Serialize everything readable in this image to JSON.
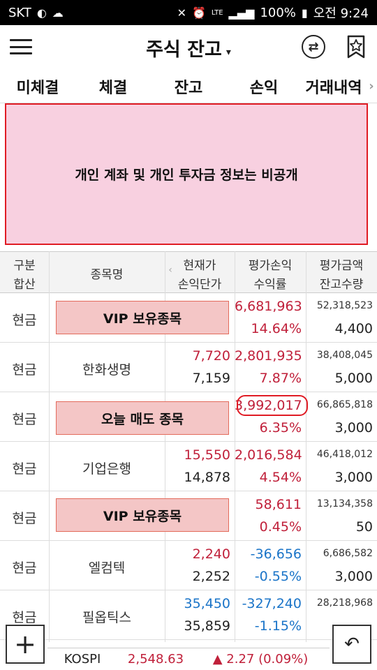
{
  "status_bar": {
    "carrier": "SKT",
    "battery": "100%",
    "time": "오전 9:24",
    "network": "LTE"
  },
  "header": {
    "title": "주식 잔고",
    "caret": "▾",
    "switch_icon": "⇄"
  },
  "tabs": [
    {
      "label": "미체결"
    },
    {
      "label": "체결"
    },
    {
      "label": "잔고"
    },
    {
      "label": "손익"
    },
    {
      "label": "거래내역"
    }
  ],
  "tab_more": "›",
  "privacy_notice": "개인 계좌 및 개인 투자금 정보는 비공개",
  "columns": {
    "category_top": "구분",
    "category_bottom": "합산",
    "name": "종목명",
    "price_top": "현재가",
    "price_bottom": "손익단가",
    "pl_top": "평가손익",
    "pl_bottom": "수익률",
    "eval_top": "평가금액",
    "eval_bottom": "잔고수량"
  },
  "rows": [
    {
      "category": "현금",
      "name": "",
      "price": "",
      "cost": "",
      "pl": "6,681,963",
      "rate": "14.64%",
      "eval": "52,318,523",
      "qty": "4,400",
      "pl_color": "red"
    },
    {
      "category": "현금",
      "name": "한화생명",
      "price": "7,720",
      "cost": "7,159",
      "pl": "2,801,935",
      "rate": "7.87%",
      "eval": "38,408,045",
      "qty": "5,000",
      "pl_color": "red"
    },
    {
      "category": "현금",
      "name": "",
      "price": "",
      "cost": "",
      "pl": "3,992,017",
      "rate": "6.35%",
      "eval": "66,865,818",
      "qty": "3,000",
      "pl_color": "red"
    },
    {
      "category": "현금",
      "name": "기업은행",
      "price": "15,550",
      "cost": "14,878",
      "pl": "2,016,584",
      "rate": "4.54%",
      "eval": "46,418,012",
      "qty": "3,000",
      "pl_color": "red"
    },
    {
      "category": "현금",
      "name": "",
      "price": "",
      "cost": "",
      "pl": "58,611",
      "rate": "0.45%",
      "eval": "13,134,358",
      "qty": "50",
      "pl_color": "red"
    },
    {
      "category": "현금",
      "name": "엘컴텍",
      "price": "2,240",
      "cost": "2,252",
      "pl": "-36,656",
      "rate": "-0.55%",
      "eval": "6,686,582",
      "qty": "3,000",
      "pl_color": "blue"
    },
    {
      "category": "현금",
      "name": "필옵틱스",
      "price": "35,450",
      "cost": "35,859",
      "pl": "-327,240",
      "rate": "-1.15%",
      "eval": "28,218,968",
      "qty": "",
      "pl_color": "blue"
    }
  ],
  "overlays": {
    "vip1": "VIP 보유종목",
    "sold_today": "오늘 매도 종목",
    "vip2": "VIP 보유종목"
  },
  "index": {
    "name": "KOSPI",
    "value": "2,548.63",
    "change": "▲ 2.27 (0.09%)"
  },
  "colors": {
    "up": "#c0203a",
    "down": "#1a74c8",
    "privacy_border": "#e01b24"
  }
}
